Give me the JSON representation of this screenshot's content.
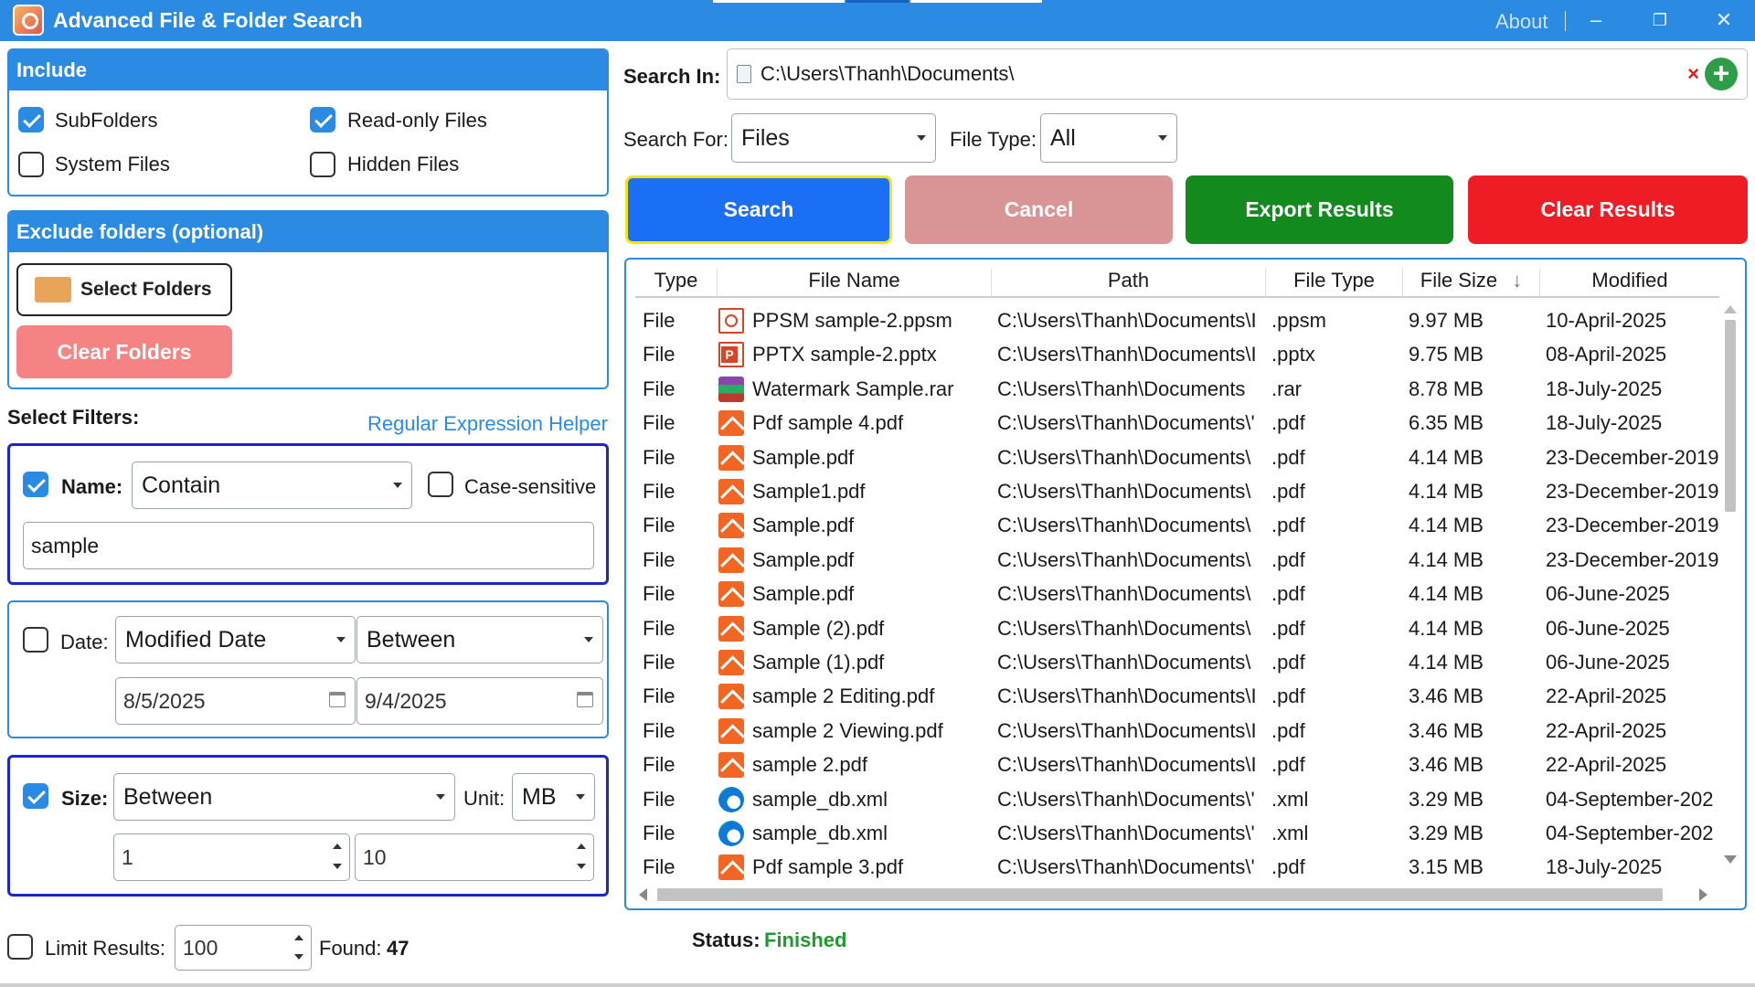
{
  "window": {
    "title": "Advanced File & Folder Search",
    "about": "About",
    "minimize": "–",
    "restore": "❐",
    "close": "✕"
  },
  "include": {
    "heading": "Include",
    "subfolders": {
      "label": "SubFolders",
      "checked": true
    },
    "readonly": {
      "label": "Read-only Files",
      "checked": true
    },
    "system": {
      "label": "System Files",
      "checked": false
    },
    "hidden": {
      "label": "Hidden Files",
      "checked": false
    }
  },
  "exclude": {
    "heading": "Exclude folders (optional)",
    "select_label": "Select Folders",
    "clear_label": "Clear Folders"
  },
  "filters": {
    "heading": "Select Filters:",
    "regex_link": "Regular Expression Helper",
    "name": {
      "checked": true,
      "label": "Name:",
      "mode": "Contain",
      "case_label": "Case-sensitive",
      "case_checked": false,
      "value": "sample"
    },
    "date": {
      "checked": false,
      "label": "Date:",
      "field": "Modified Date",
      "mode": "Between",
      "from": "8/5/2025",
      "to": "9/4/2025"
    },
    "size": {
      "checked": true,
      "label": "Size:",
      "mode": "Between",
      "unit_label": "Unit:",
      "unit": "MB",
      "min": "1",
      "max": "10"
    }
  },
  "limit": {
    "label": "Limit Results:",
    "checked": false,
    "value": "100",
    "found_label": "Found:",
    "found": "47"
  },
  "search": {
    "in_label": "Search In:",
    "path": "C:\\Users\\Thanh\\Documents\\",
    "for_label": "Search For:",
    "for_value": "Files",
    "type_label": "File Type:",
    "type_value": "All"
  },
  "buttons": {
    "search": "Search",
    "cancel": "Cancel",
    "export": "Export Results",
    "clear": "Clear Results"
  },
  "colors": {
    "accent": "#2b8be3",
    "search": "#1a6ff5",
    "cancel": "#d99596",
    "export": "#128a1e",
    "clear": "#ee1c24",
    "status_ok": "#1f9a2e"
  },
  "table": {
    "columns": [
      "Type",
      "File Name",
      "Path",
      "File Type",
      "File Size",
      "Modified"
    ],
    "sort_indicator": "↓",
    "rows": [
      {
        "type": "File",
        "icon": "ppsm-icon",
        "name": "PPSM sample-2.ppsm",
        "path": "C:\\Users\\Thanh\\Documents\\I",
        "ext": ".ppsm",
        "size": "9.97 MB",
        "modified": "10-April-2025"
      },
      {
        "type": "File",
        "icon": "pptx-icon",
        "name": "PPTX sample-2.pptx",
        "path": "C:\\Users\\Thanh\\Documents\\I",
        "ext": ".pptx",
        "size": "9.75 MB",
        "modified": "08-April-2025"
      },
      {
        "type": "File",
        "icon": "rar-icon",
        "name": "Watermark Sample.rar",
        "path": "C:\\Users\\Thanh\\Documents",
        "ext": ".rar",
        "size": "8.78 MB",
        "modified": "18-July-2025"
      },
      {
        "type": "File",
        "icon": "pdf-icon",
        "name": "Pdf sample 4.pdf",
        "path": "C:\\Users\\Thanh\\Documents\\'",
        "ext": ".pdf",
        "size": "6.35 MB",
        "modified": "18-July-2025"
      },
      {
        "type": "File",
        "icon": "pdf-icon",
        "name": "Sample.pdf",
        "path": "C:\\Users\\Thanh\\Documents\\",
        "ext": ".pdf",
        "size": "4.14 MB",
        "modified": "23-December-2019"
      },
      {
        "type": "File",
        "icon": "pdf-icon",
        "name": "Sample1.pdf",
        "path": "C:\\Users\\Thanh\\Documents\\",
        "ext": ".pdf",
        "size": "4.14 MB",
        "modified": "23-December-2019"
      },
      {
        "type": "File",
        "icon": "pdf-icon",
        "name": "Sample.pdf",
        "path": "C:\\Users\\Thanh\\Documents\\",
        "ext": ".pdf",
        "size": "4.14 MB",
        "modified": "23-December-2019"
      },
      {
        "type": "File",
        "icon": "pdf-icon",
        "name": "Sample.pdf",
        "path": "C:\\Users\\Thanh\\Documents\\",
        "ext": ".pdf",
        "size": "4.14 MB",
        "modified": "23-December-2019"
      },
      {
        "type": "File",
        "icon": "pdf-icon",
        "name": "Sample.pdf",
        "path": "C:\\Users\\Thanh\\Documents\\",
        "ext": ".pdf",
        "size": "4.14 MB",
        "modified": "06-June-2025"
      },
      {
        "type": "File",
        "icon": "pdf-icon",
        "name": "Sample (2).pdf",
        "path": "C:\\Users\\Thanh\\Documents\\",
        "ext": ".pdf",
        "size": "4.14 MB",
        "modified": "06-June-2025"
      },
      {
        "type": "File",
        "icon": "pdf-icon",
        "name": "Sample (1).pdf",
        "path": "C:\\Users\\Thanh\\Documents\\",
        "ext": ".pdf",
        "size": "4.14 MB",
        "modified": "06-June-2025"
      },
      {
        "type": "File",
        "icon": "pdf-icon",
        "name": "sample 2 Editing.pdf",
        "path": "C:\\Users\\Thanh\\Documents\\I",
        "ext": ".pdf",
        "size": "3.46 MB",
        "modified": "22-April-2025"
      },
      {
        "type": "File",
        "icon": "pdf-icon",
        "name": "sample 2 Viewing.pdf",
        "path": "C:\\Users\\Thanh\\Documents\\I",
        "ext": ".pdf",
        "size": "3.46 MB",
        "modified": "22-April-2025"
      },
      {
        "type": "File",
        "icon": "pdf-icon",
        "name": "sample 2.pdf",
        "path": "C:\\Users\\Thanh\\Documents\\I",
        "ext": ".pdf",
        "size": "3.46 MB",
        "modified": "22-April-2025"
      },
      {
        "type": "File",
        "icon": "xml-icon",
        "name": "sample_db.xml",
        "path": "C:\\Users\\Thanh\\Documents\\'",
        "ext": ".xml",
        "size": "3.29 MB",
        "modified": "04-September-202"
      },
      {
        "type": "File",
        "icon": "xml-icon",
        "name": "sample_db.xml",
        "path": "C:\\Users\\Thanh\\Documents\\'",
        "ext": ".xml",
        "size": "3.29 MB",
        "modified": "04-September-202"
      },
      {
        "type": "File",
        "icon": "pdf-icon",
        "name": "Pdf sample 3.pdf",
        "path": "C:\\Users\\Thanh\\Documents\\'",
        "ext": ".pdf",
        "size": "3.15 MB",
        "modified": "18-July-2025"
      }
    ]
  },
  "status": {
    "label": "Status:",
    "value": "Finished"
  }
}
